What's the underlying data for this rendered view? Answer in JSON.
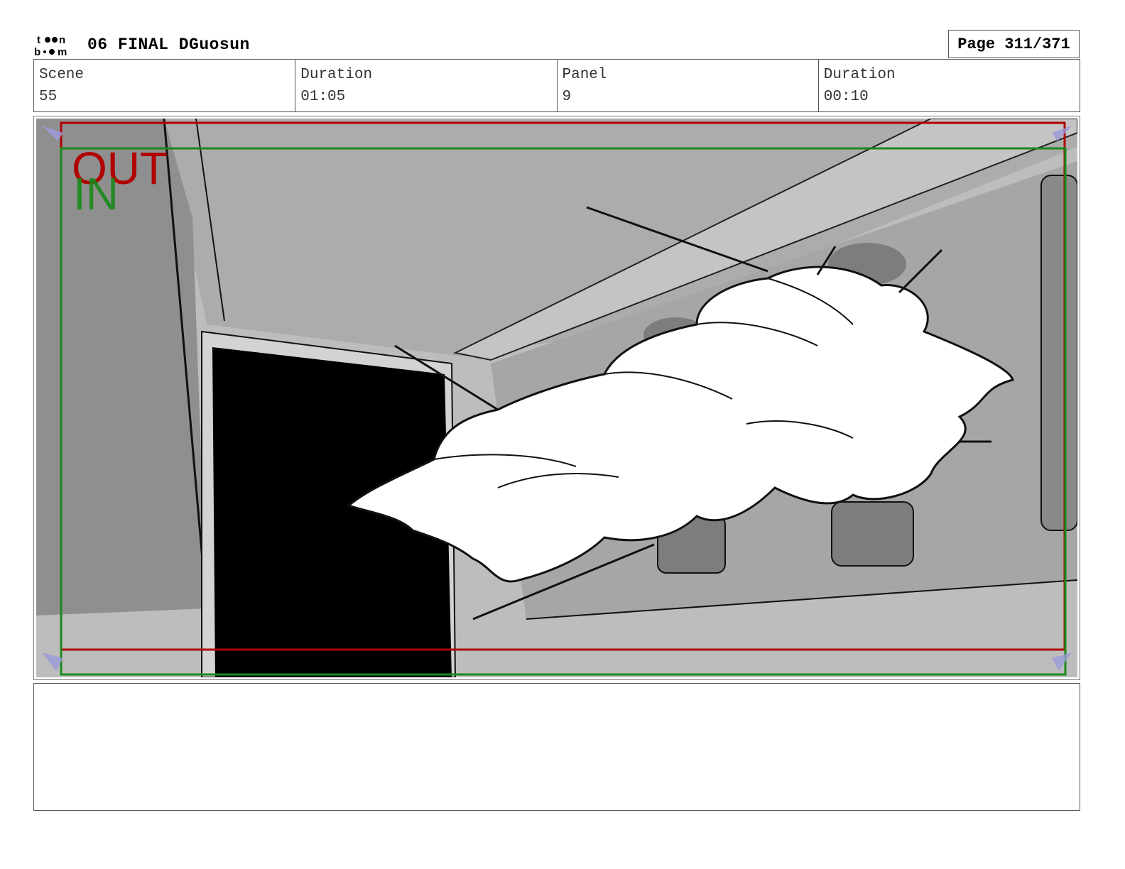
{
  "header": {
    "title": "06 FINAL DGuosun",
    "page": "Page 311/371",
    "logo": {
      "line1": "toon",
      "line2": "boom"
    }
  },
  "info": {
    "scene_label": "Scene",
    "scene_value": "55",
    "scene_duration_label": "Duration",
    "scene_duration_value": "01:05",
    "panel_label": "Panel",
    "panel_value": "9",
    "panel_duration_label": "Duration",
    "panel_duration_value": "00:10"
  },
  "frame": {
    "out_label": "OUT",
    "in_label": "IN",
    "out_color": "#b00000",
    "in_color": "#1a8a1a"
  },
  "notes": {
    "text": ""
  }
}
